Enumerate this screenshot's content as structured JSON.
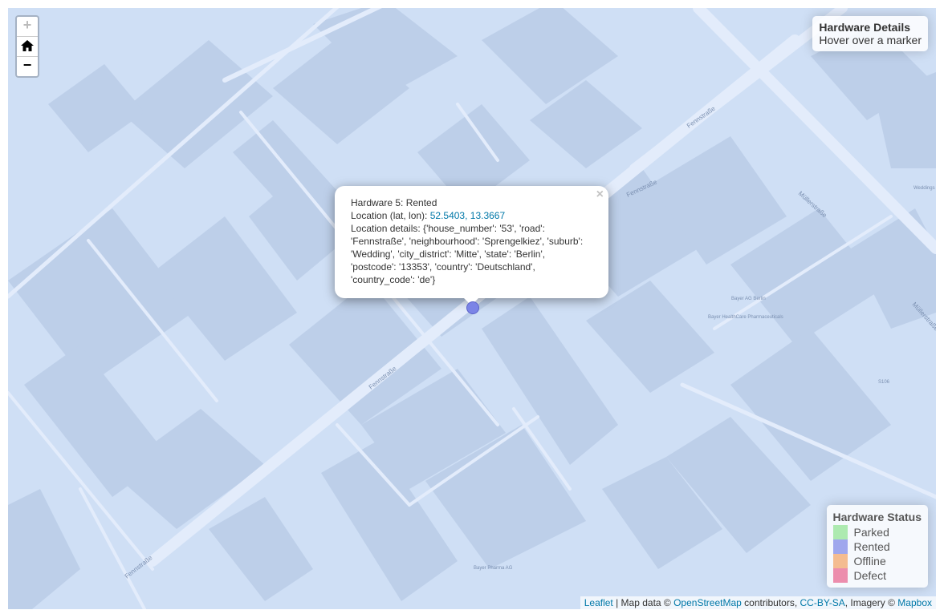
{
  "zoom": {
    "in_label": "+",
    "home_label": "⌂",
    "out_label": "−"
  },
  "info": {
    "title": "Hardware Details",
    "subtitle": "Hover over a marker"
  },
  "popup": {
    "line1": "Hardware 5: Rented",
    "loc_prefix": "Location (lat, lon): ",
    "loc_link": "52.5403, 13.3667",
    "details": "Location details: {'house_number': '53', 'road': 'Fennstraße', 'neighbourhood': 'Sprengelkiez', 'suburb': 'Wedding', 'city_district': 'Mitte', 'state': 'Berlin', 'postcode': '13353', 'country': 'Deutschland', 'country_code': 'de'}",
    "close": "×"
  },
  "legend": {
    "title": "Hardware Status",
    "items": [
      {
        "label": "Parked",
        "color": "#8fe48f"
      },
      {
        "label": "Rented",
        "color": "#7b84e6"
      },
      {
        "label": "Offline",
        "color": "#f4a261"
      },
      {
        "label": "Defect",
        "color": "#e8608a"
      }
    ]
  },
  "attribution": {
    "leaflet": "Leaflet",
    "sep1": " | Map data © ",
    "osm": "OpenStreetMap",
    "sep2": " contributors, ",
    "license": "CC-BY-SA",
    "sep3": ", Imagery © ",
    "mapbox": "Mapbox"
  },
  "map_labels": {
    "street1": "Fennstraße",
    "street2": "Fennstraße",
    "street3": "Fennstraße",
    "street4": "Fennstraße",
    "street5": "Müllerstraße",
    "street6": "Müllerstraße",
    "poi1": "Bayer AG Berlin",
    "poi2": "Bayer HealthCare Pharmaceuticals",
    "poi3": "Bayer Pharma AG",
    "poi4": "Weddings",
    "poi5": "S106"
  }
}
